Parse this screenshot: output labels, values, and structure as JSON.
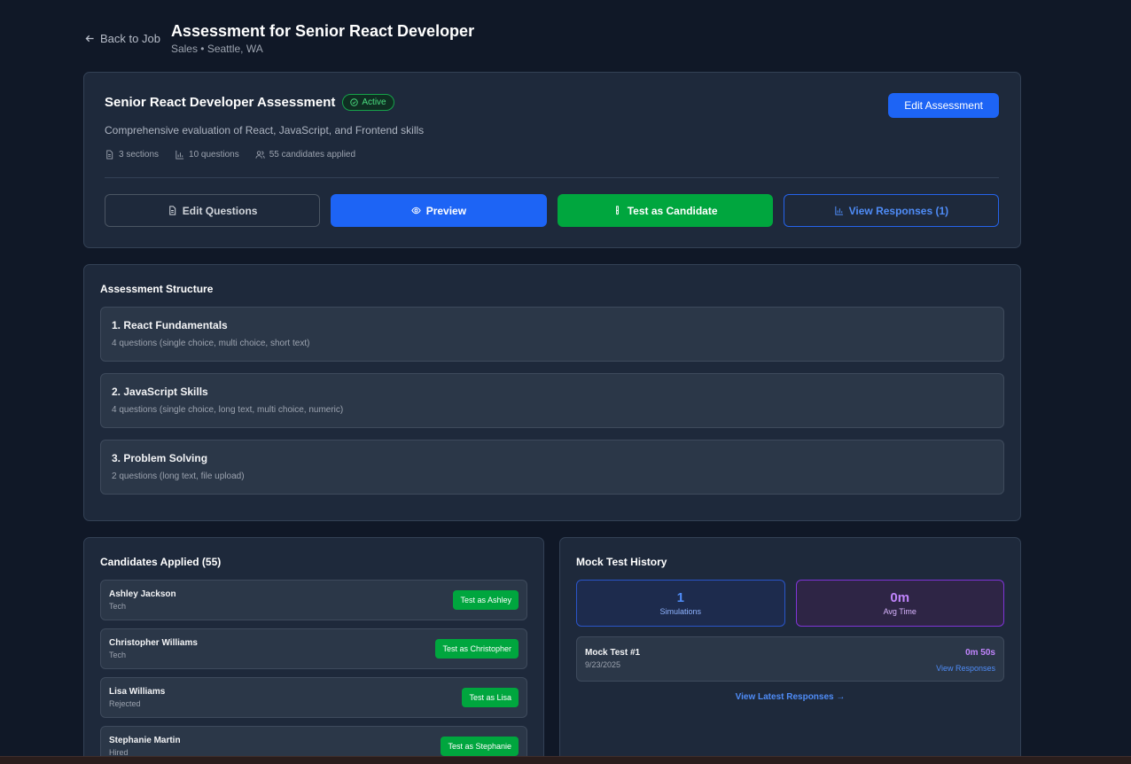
{
  "header": {
    "back_label": "Back to Job",
    "title": "Assessment for Senior React Developer",
    "subtitle": "Sales • Seattle, WA"
  },
  "assessment": {
    "name": "Senior React Developer Assessment",
    "status": "Active",
    "edit_label": "Edit Assessment",
    "description": "Comprehensive evaluation of React, JavaScript, and Frontend skills",
    "meta": {
      "sections": "3 sections",
      "questions": "10 questions",
      "candidates": "55 candidates applied"
    },
    "actions": {
      "edit_questions": "Edit Questions",
      "preview": "Preview",
      "test_candidate": "Test as Candidate",
      "view_responses": "View Responses (1)"
    }
  },
  "structure": {
    "title": "Assessment Structure",
    "sections": [
      {
        "name": "1. React Fundamentals",
        "detail": "4 questions  (single choice, multi choice, short text)"
      },
      {
        "name": "2. JavaScript Skills",
        "detail": "4 questions  (single choice, long text, multi choice, numeric)"
      },
      {
        "name": "3. Problem Solving",
        "detail": "2 questions  (long text, file upload)"
      }
    ]
  },
  "candidates": {
    "title": "Candidates Applied (55)",
    "items": [
      {
        "name": "Ashley Jackson",
        "status": "Tech",
        "button": "Test as Ashley"
      },
      {
        "name": "Christopher Williams",
        "status": "Tech",
        "button": "Test as Christopher"
      },
      {
        "name": "Lisa Williams",
        "status": "Rejected",
        "button": "Test as Lisa"
      },
      {
        "name": "Stephanie Martin",
        "status": "Hired",
        "button": "Test as Stephanie"
      }
    ]
  },
  "mock_history": {
    "title": "Mock Test History",
    "simulations_value": "1",
    "simulations_label": "Simulations",
    "avg_time_value": "0m",
    "avg_time_label": "Avg Time",
    "tests": [
      {
        "name": "Mock Test #1",
        "date": "9/23/2025",
        "time": "0m 50s",
        "link": "View Responses"
      }
    ],
    "view_latest": "View Latest Responses →"
  },
  "colors": {
    "background": "#101827",
    "card": "#1e293b",
    "primary_blue": "#1d64f5",
    "success_green": "#00a63e",
    "accent_purple": "#c084fc"
  },
  "icons": [
    "arrow-left-icon",
    "check-circle-icon",
    "file-icon",
    "bar-chart-icon",
    "users-icon",
    "eye-icon",
    "flask-icon"
  ]
}
